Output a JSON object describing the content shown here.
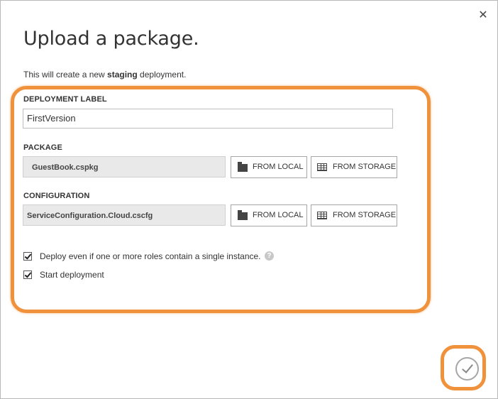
{
  "dialog": {
    "title": "Upload a package.",
    "subtitle_prefix": "This will create a new ",
    "subtitle_bold": "staging",
    "subtitle_suffix": " deployment.",
    "close_glyph": "✕"
  },
  "form": {
    "deployment_label": {
      "label": "DEPLOYMENT LABEL",
      "value": "FirstVersion"
    },
    "package": {
      "label": "PACKAGE",
      "file": "GuestBook.cspkg",
      "from_local": "FROM LOCAL",
      "from_storage": "FROM STORAGE"
    },
    "configuration": {
      "label": "CONFIGURATION",
      "file": "ServiceConfiguration.Cloud.cscfg",
      "from_local": "FROM LOCAL",
      "from_storage": "FROM STORAGE"
    },
    "options": [
      {
        "label": "Deploy even if one or more roles contain a single instance.",
        "checked": true
      },
      {
        "label": "Start deployment",
        "checked": true
      }
    ],
    "help_glyph": "?"
  },
  "colors": {
    "highlight": "#f0923c",
    "field_bg": "#e9e9e9"
  },
  "icons": {
    "close": "close-icon",
    "folder": "folder-icon",
    "storage": "table-icon",
    "help": "help-icon",
    "confirm": "checkmark-icon"
  }
}
